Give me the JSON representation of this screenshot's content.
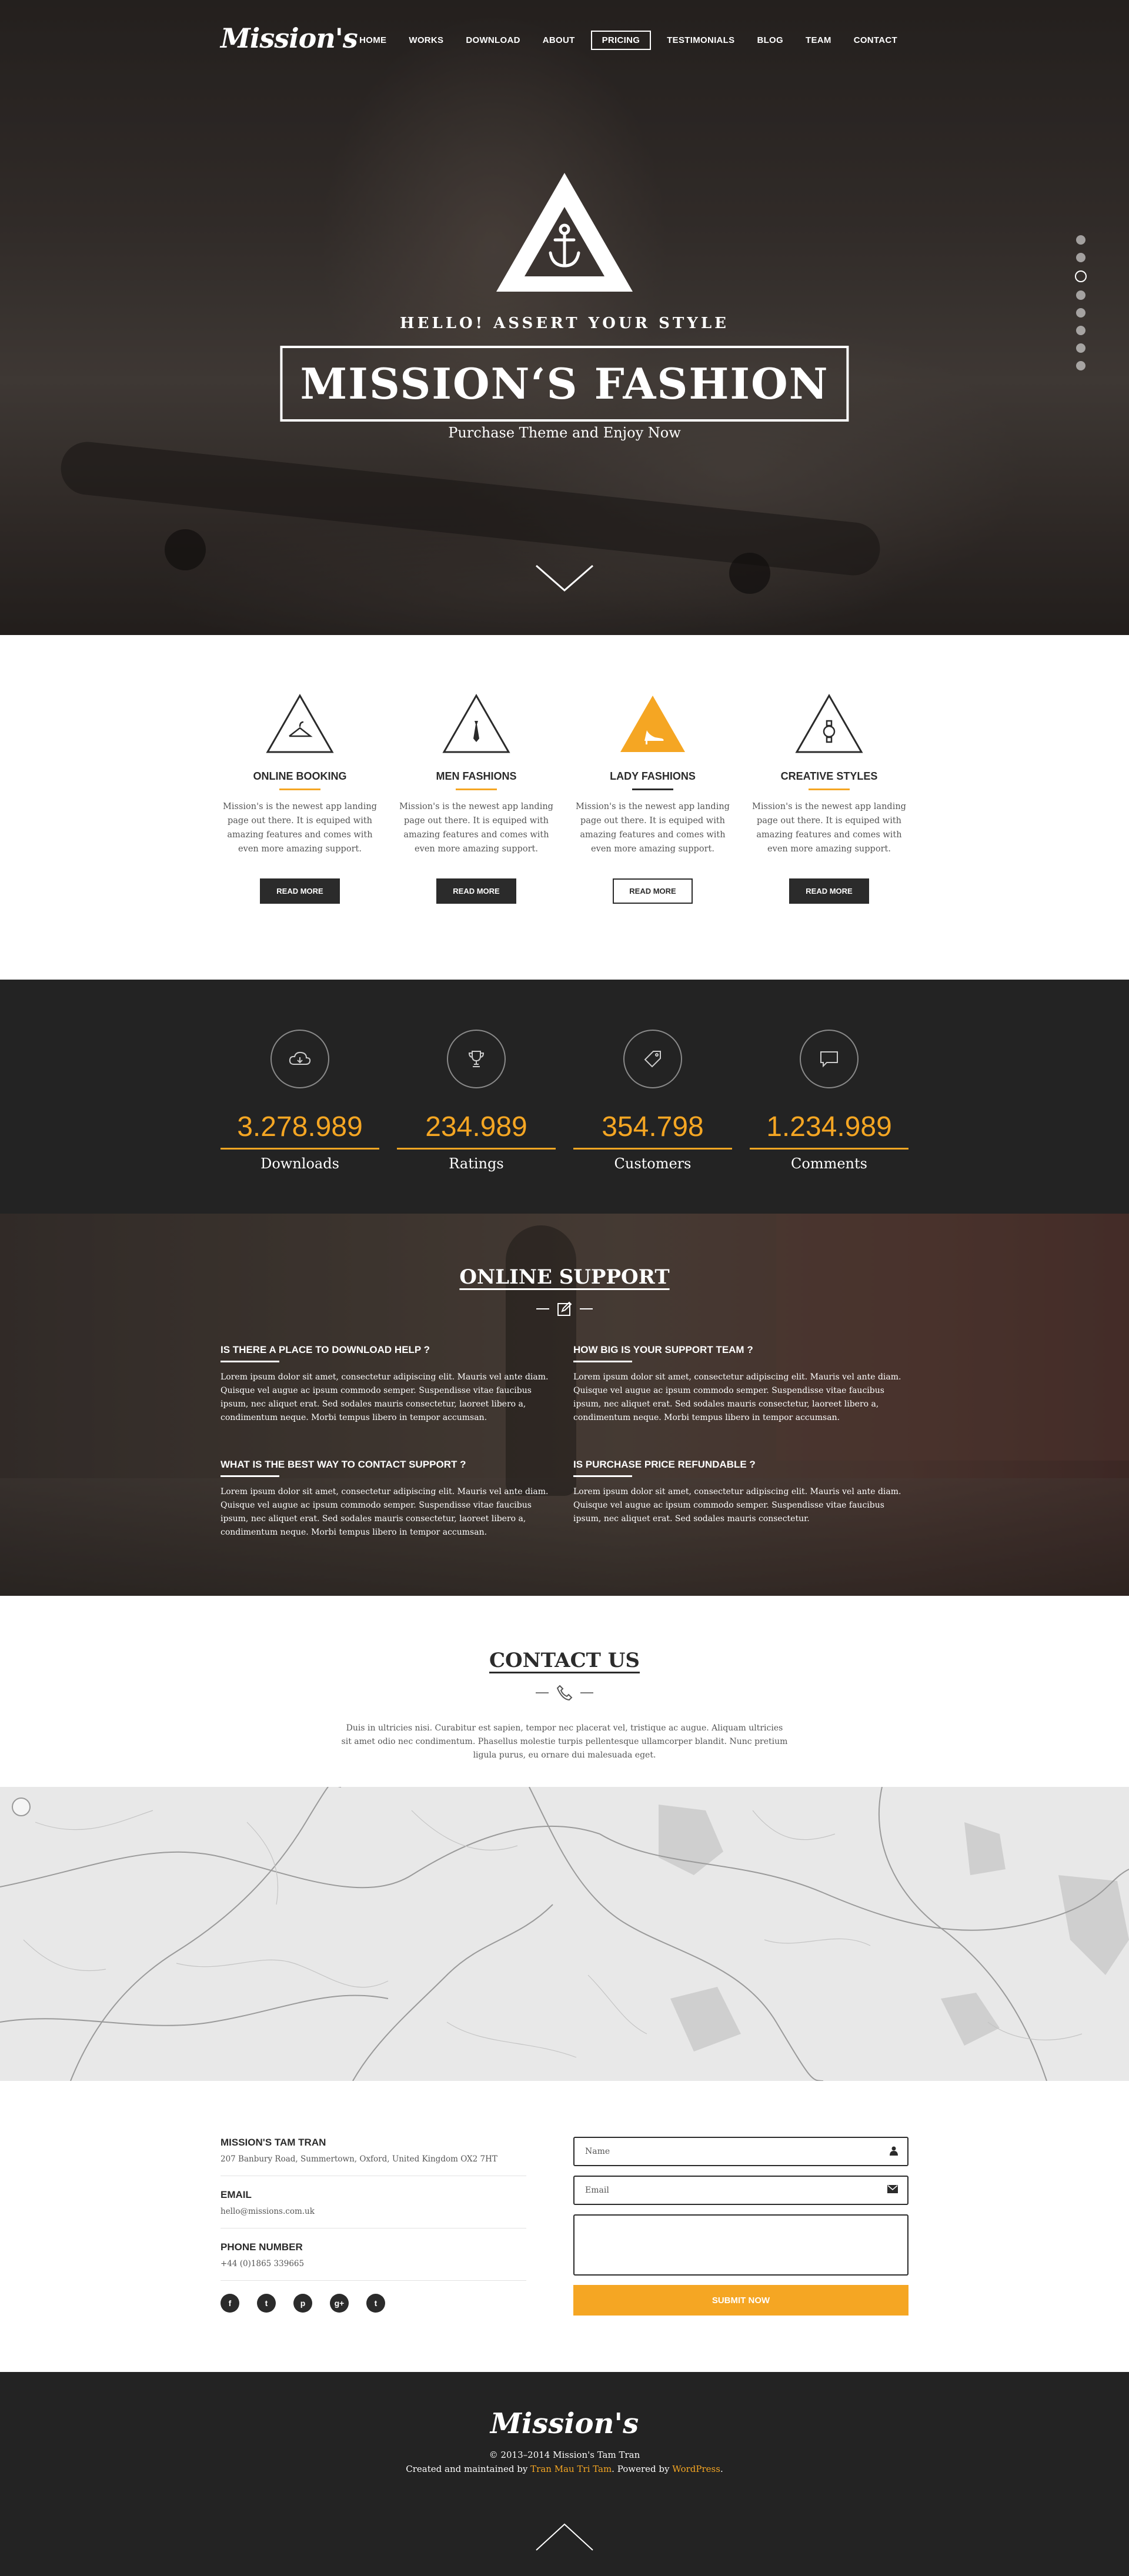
{
  "nav": {
    "logo": "Mission's",
    "items": [
      "HOME",
      "WORKS",
      "DOWNLOAD",
      "ABOUT",
      "PRICING",
      "TESTIMONIALS",
      "BLOG",
      "TEAM",
      "CONTACT"
    ],
    "active": "PRICING"
  },
  "hero": {
    "tagline": "HELLO! ASSERT YOUR STYLE",
    "title": "MISSION‘S FASHION",
    "subtitle": "Purchase Theme and Enjoy Now",
    "slider_dots": 8,
    "active_dot": 3
  },
  "features": [
    {
      "title": "ONLINE BOOKING",
      "icon": "hanger-icon",
      "text": "Mission's is the newest app landing page out there. It is equiped with amazing features and comes with even more amazing support.",
      "button": "READ MORE",
      "highlight": false
    },
    {
      "title": "MEN FASHIONS",
      "icon": "tie-icon",
      "text": "Mission's is the newest app landing page out there. It is equiped with amazing features and comes with even more amazing support.",
      "button": "READ MORE",
      "highlight": false
    },
    {
      "title": "LADY FASHIONS",
      "icon": "heel-icon",
      "text": "Mission's is the newest app landing page out there. It is equiped with amazing features and comes with even more amazing support.",
      "button": "READ MORE",
      "highlight": true
    },
    {
      "title": "CREATIVE STYLES",
      "icon": "watch-icon",
      "text": "Mission's is the newest app landing page out there. It is equiped with amazing features and comes with even more amazing support.",
      "button": "READ MORE",
      "highlight": false
    }
  ],
  "stats": [
    {
      "value": "3.278.989",
      "label": "Downloads",
      "icon": "cloud-download-icon"
    },
    {
      "value": "234.989",
      "label": "Ratings",
      "icon": "trophy-icon"
    },
    {
      "value": "354.798",
      "label": "Customers",
      "icon": "tag-icon"
    },
    {
      "value": "1.234.989",
      "label": "Comments",
      "icon": "comment-icon"
    }
  ],
  "support": {
    "title": "ONLINE SUPPORT",
    "faqs": [
      {
        "q": "IS THERE A PLACE TO DOWNLOAD HELP ?",
        "a": "Lorem ipsum dolor sit amet, consectetur adipiscing elit. Mauris vel ante diam. Quisque vel augue ac ipsum commodo semper. Suspendisse vitae faucibus ipsum, nec aliquet erat. Sed sodales mauris consectetur, laoreet libero a, condimentum neque. Morbi tempus libero in tempor accumsan."
      },
      {
        "q": "HOW BIG IS YOUR SUPPORT TEAM ?",
        "a": "Lorem ipsum dolor sit amet, consectetur adipiscing elit. Mauris vel ante diam. Quisque vel augue ac ipsum commodo semper. Suspendisse vitae faucibus ipsum, nec aliquet erat. Sed sodales mauris consectetur, laoreet libero a, condimentum neque. Morbi tempus libero in tempor accumsan."
      },
      {
        "q": "WHAT IS THE BEST WAY TO CONTACT SUPPORT ?",
        "a": "Lorem ipsum dolor sit amet, consectetur adipiscing elit. Mauris vel ante diam. Quisque vel augue ac ipsum commodo semper. Suspendisse vitae faucibus ipsum, nec aliquet erat. Sed sodales mauris consectetur, laoreet libero a, condimentum neque. Morbi tempus libero in tempor accumsan."
      },
      {
        "q": "IS PURCHASE PRICE REFUNDABLE ?",
        "a": "Lorem ipsum dolor sit amet, consectetur adipiscing elit. Mauris vel ante diam. Quisque vel augue ac ipsum commodo semper. Suspendisse vitae faucibus ipsum, nec aliquet erat. Sed sodales mauris consectetur."
      }
    ]
  },
  "contact": {
    "title": "CONTACT US",
    "text": "Duis in ultricies nisi. Curabitur est sapien, tempor nec placerat vel, tristique ac augue. Aliquam ultricies sit amet odio nec condimentum. Phasellus molestie turpis pellentesque ullamcorper blandit. Nunc pretium ligula purus, eu ornare dui malesuada eget."
  },
  "info": {
    "company_h": "MISSION'S TAM TRAN",
    "address": "207 Banbury Road, Summertown, Oxford, United Kingdom OX2 7HT",
    "email_h": "EMAIL",
    "email": "hello@missions.com.uk",
    "phone_h": "PHONE NUMBER",
    "phone": "+44 (0)1865 339665",
    "socials": [
      "f",
      "t",
      "p",
      "g+",
      "t"
    ],
    "form": {
      "name": "Name",
      "email": "Email",
      "submit": "SUBMIT NOW"
    }
  },
  "footer": {
    "logo": "Mission's",
    "copyright": "© 2013–2014 Mission's Tam Tran",
    "credit_pre": "Created and maintained by ",
    "credit_author": "Tran Mau Tri Tam",
    "credit_mid": ". Powered by ",
    "credit_wp": "WordPress",
    "credit_end": "."
  },
  "colors": {
    "accent": "#f5a623",
    "dark": "#232323",
    "text": "#555555"
  }
}
